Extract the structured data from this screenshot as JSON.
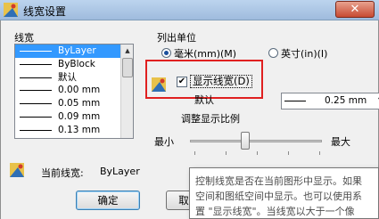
{
  "window": {
    "title": "线宽设置",
    "close_glyph": "✕"
  },
  "lineweights": {
    "label": "线宽",
    "items": [
      {
        "label": "ByLayer",
        "selected": true,
        "has_line": true
      },
      {
        "label": "ByBlock",
        "selected": false,
        "has_line": true
      },
      {
        "label": "默认",
        "selected": false,
        "has_line": true
      },
      {
        "label": "0.00 mm",
        "selected": false,
        "has_line": true
      },
      {
        "label": "0.05 mm",
        "selected": false,
        "has_line": true
      },
      {
        "label": "0.09 mm",
        "selected": false,
        "has_line": true
      },
      {
        "label": "0.13 mm",
        "selected": false,
        "has_line": true
      }
    ]
  },
  "units": {
    "title": "列出单位",
    "mm_label": "毫米(mm)(M)",
    "in_label": "英寸(in)(I)",
    "selected": "mm"
  },
  "display": {
    "checkbox_label": "显示线宽(D)",
    "checked": true,
    "check_glyph": "✔",
    "default_label": "默认",
    "default_value": "0.25 mm"
  },
  "scale": {
    "title": "调整显示比例",
    "min_label": "最小",
    "max_label": "最大"
  },
  "current": {
    "label": "当前线宽:",
    "value": "ByLayer"
  },
  "buttons": {
    "ok": "确定",
    "cancel": "取"
  },
  "tooltip": {
    "lines": [
      "控制线宽是否在当前图形中显示。如果",
      "空间和图纸空间中显示。也可以使用系",
      "置 \"显示线宽\"。当线宽以大于一个像"
    ]
  },
  "colors": {
    "highlight_box": "#e02020",
    "selection": "#3399ff"
  }
}
